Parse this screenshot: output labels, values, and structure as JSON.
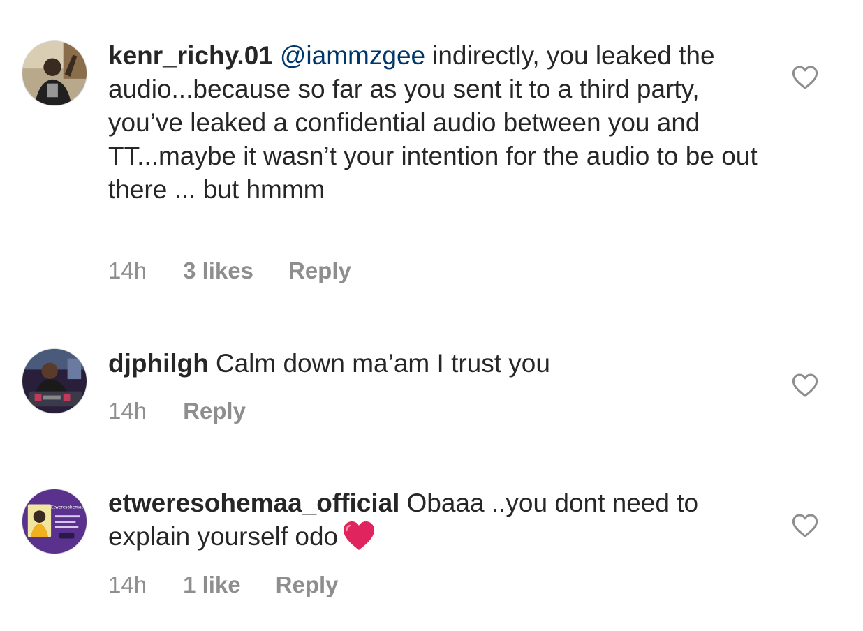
{
  "comments": [
    {
      "username": "kenr_richy.01",
      "mention": "@iammzgee",
      "text": "indirectly, you leaked the audio...because so far as you sent it to a third party, you’ve leaked a confidential audio between you and TT...maybe it wasn’t your intention for the audio to be out there ... but hmmm",
      "time": "14h",
      "likes": "3 likes",
      "reply": "Reply",
      "like_icon": "heart-outline-icon"
    },
    {
      "username": "djphilgh",
      "text": "Calm down ma’am I trust you",
      "time": "14h",
      "reply": "Reply",
      "like_icon": "heart-outline-icon"
    },
    {
      "username": "etweresohemaa_official",
      "text": "Obaaa ..you dont need to explain yourself odo",
      "emoji": "red-heart-emoji",
      "time": "14h",
      "likes": "1 like",
      "reply": "Reply",
      "like_icon": "heart-outline-icon",
      "avatar_text": "Etweresohemaa"
    }
  ],
  "colors": {
    "text": "#262626",
    "secondary": "#8e8e8e",
    "mention": "#00376b",
    "heart_emoji": "#e0245e"
  }
}
